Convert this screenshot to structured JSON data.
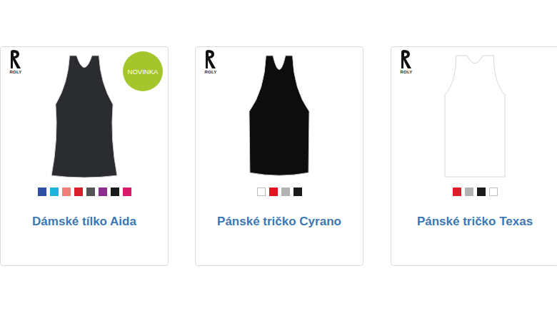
{
  "products": [
    {
      "brand": "ROLY",
      "badge": "NOVINKA",
      "title": "Dámské tílko Aida",
      "image": {
        "kind": "racerback-women",
        "color": "#2b2c30"
      },
      "swatches": [
        {
          "color": "#2f4fa3"
        },
        {
          "color": "#1fb3dc"
        },
        {
          "color": "#f07f7a"
        },
        {
          "color": "#d91f2b"
        },
        {
          "color": "#555555"
        },
        {
          "color": "#8e2d8c"
        },
        {
          "color": "#1a1a1a"
        },
        {
          "color": "#d81b6a"
        }
      ]
    },
    {
      "brand": "ROLY",
      "badge": "",
      "title": "Pánské tričko Cyrano",
      "image": {
        "kind": "racerback-men",
        "color": "#0d0d0d"
      },
      "swatches": [
        {
          "color": "#ffffff"
        },
        {
          "color": "#e0141e"
        },
        {
          "color": "#b3b3b3"
        },
        {
          "color": "#1a1a1a"
        }
      ]
    },
    {
      "brand": "ROLY",
      "badge": "",
      "title": "Pánské tričko Texas",
      "image": {
        "kind": "tank",
        "color": "#ffffff"
      },
      "swatches": [
        {
          "color": "#d91f2b"
        },
        {
          "color": "#b3b3b3"
        },
        {
          "color": "#1a1a1a"
        },
        {
          "color": "#ffffff"
        }
      ]
    }
  ]
}
